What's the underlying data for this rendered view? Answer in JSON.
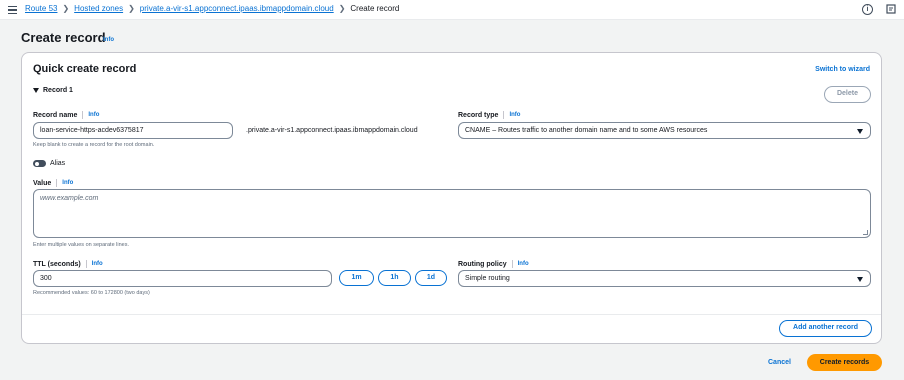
{
  "breadcrumb": {
    "items": [
      {
        "label": "Route 53"
      },
      {
        "label": "Hosted zones"
      },
      {
        "label": "private.a-vir-s1.appconnect.ipaas.ibmappdomain.cloud"
      }
    ],
    "current": "Create record"
  },
  "page": {
    "title": "Create record",
    "info": "Info"
  },
  "panel": {
    "title": "Quick create record",
    "switch_link": "Switch to wizard",
    "record_toggle": "Record 1",
    "delete_label": "Delete"
  },
  "record_name": {
    "label": "Record name",
    "info": "Info",
    "value": "loan-service-https-acdev6375817",
    "suffix": ".private.a-vir-s1.appconnect.ipaas.ibmappdomain.cloud",
    "hint": "Keep blank to create a record for the root domain."
  },
  "record_type": {
    "label": "Record type",
    "info": "Info",
    "value": "CNAME – Routes traffic to another domain name and to some AWS resources"
  },
  "alias": {
    "label": "Alias",
    "enabled": false
  },
  "value_field": {
    "label": "Value",
    "info": "Info",
    "placeholder": "www.example.com",
    "hint": "Enter multiple values on separate lines."
  },
  "ttl": {
    "label": "TTL (seconds)",
    "info": "Info",
    "value": "300",
    "hint": "Recommended values: 60 to 172800 (two days)",
    "buttons": [
      "1m",
      "1h",
      "1d"
    ]
  },
  "routing_policy": {
    "label": "Routing policy",
    "info": "Info",
    "value": "Simple routing"
  },
  "add_record_label": "Add another record",
  "footer": {
    "cancel": "Cancel",
    "create": "Create records"
  },
  "colors": {
    "link": "#0972d3",
    "primary": "#ff9900",
    "background": "#f2f3f3"
  }
}
